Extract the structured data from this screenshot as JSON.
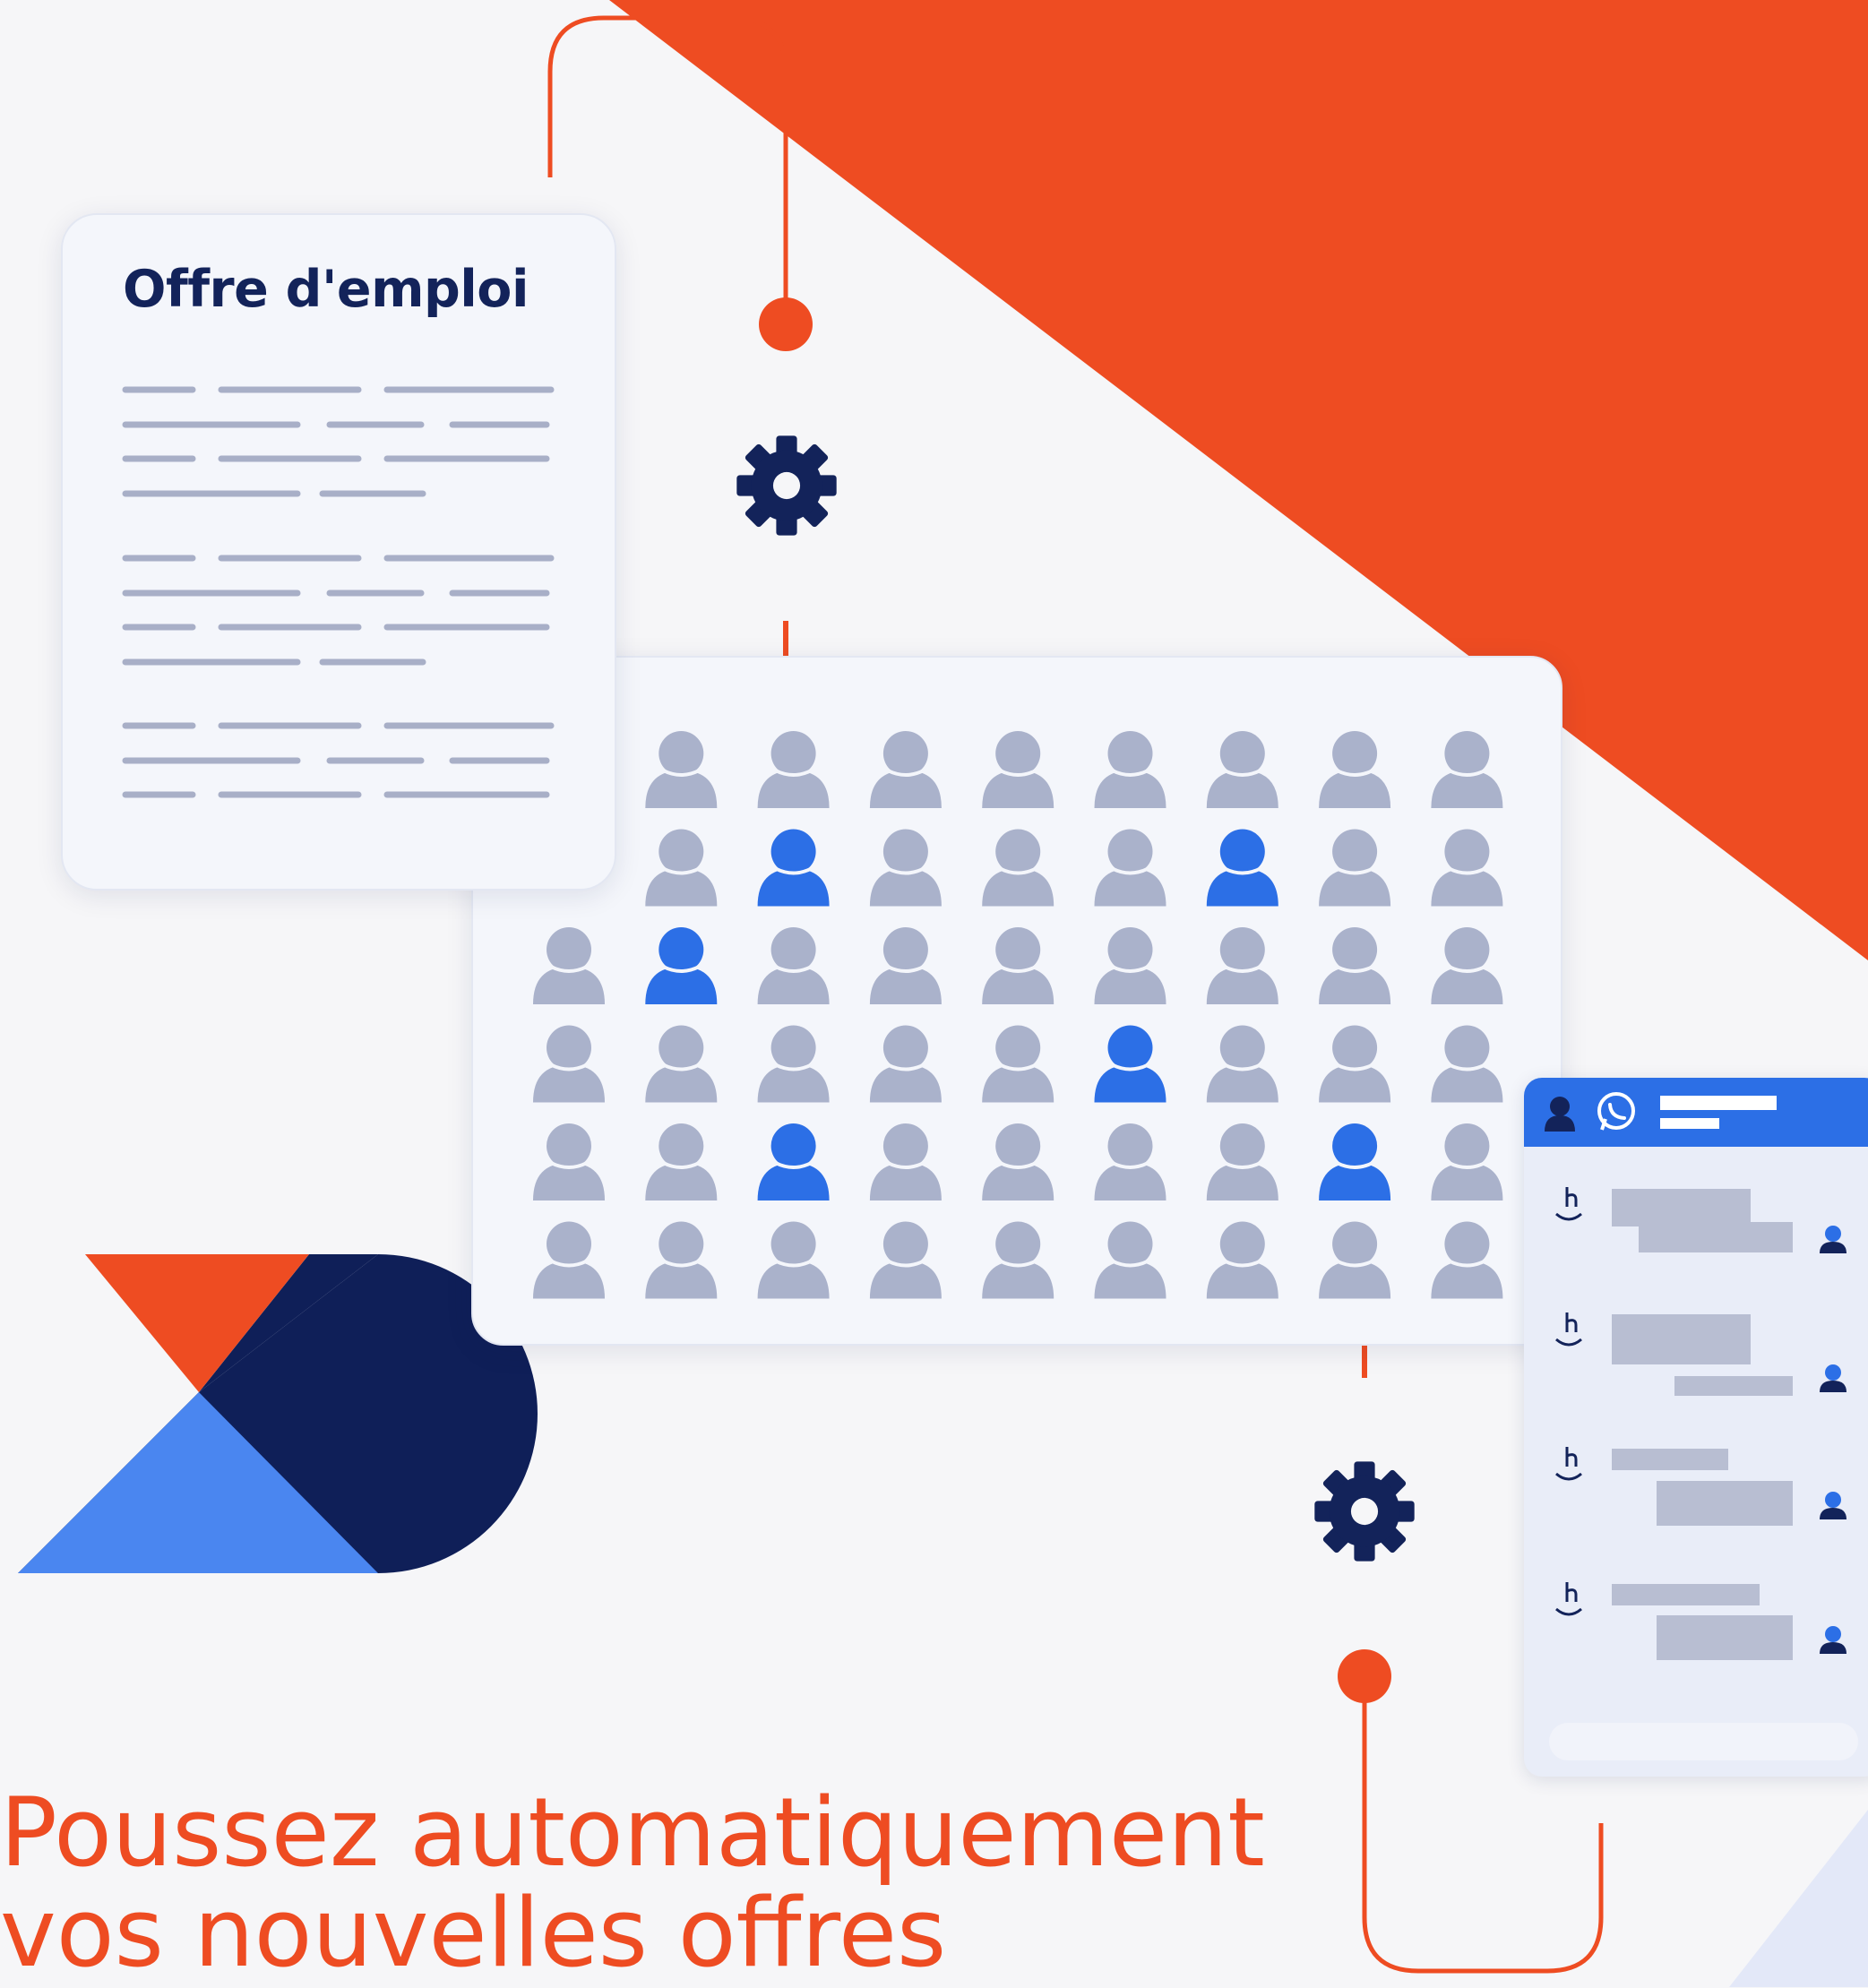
{
  "job_card": {
    "title": "Offre d'emploi"
  },
  "headline": {
    "line1": "Poussez automatiquement",
    "line2": "vos nouvelles offres"
  },
  "icons": {
    "gear_top": "gear-icon",
    "gear_bottom": "gear-icon",
    "chat_person": "person-icon",
    "chat_whatsapp": "whatsapp-icon",
    "chat_brand": "brand-h-icon",
    "candidate": "person-icon"
  },
  "candidates": {
    "columns": 9,
    "rows": 6,
    "highlighted": [
      [
        1,
        2
      ],
      [
        1,
        6
      ],
      [
        2,
        1
      ],
      [
        3,
        5
      ],
      [
        4,
        2
      ],
      [
        4,
        7
      ]
    ],
    "hidden": [
      [
        0,
        0
      ],
      [
        1,
        0
      ]
    ]
  },
  "colors": {
    "orange": "#ee4c22",
    "navy": "#13235a",
    "blue": "#2c6fe6",
    "light_blue": "#4a86f0",
    "grey_person": "#aab2cb",
    "card_bg": "#f4f6fb"
  }
}
